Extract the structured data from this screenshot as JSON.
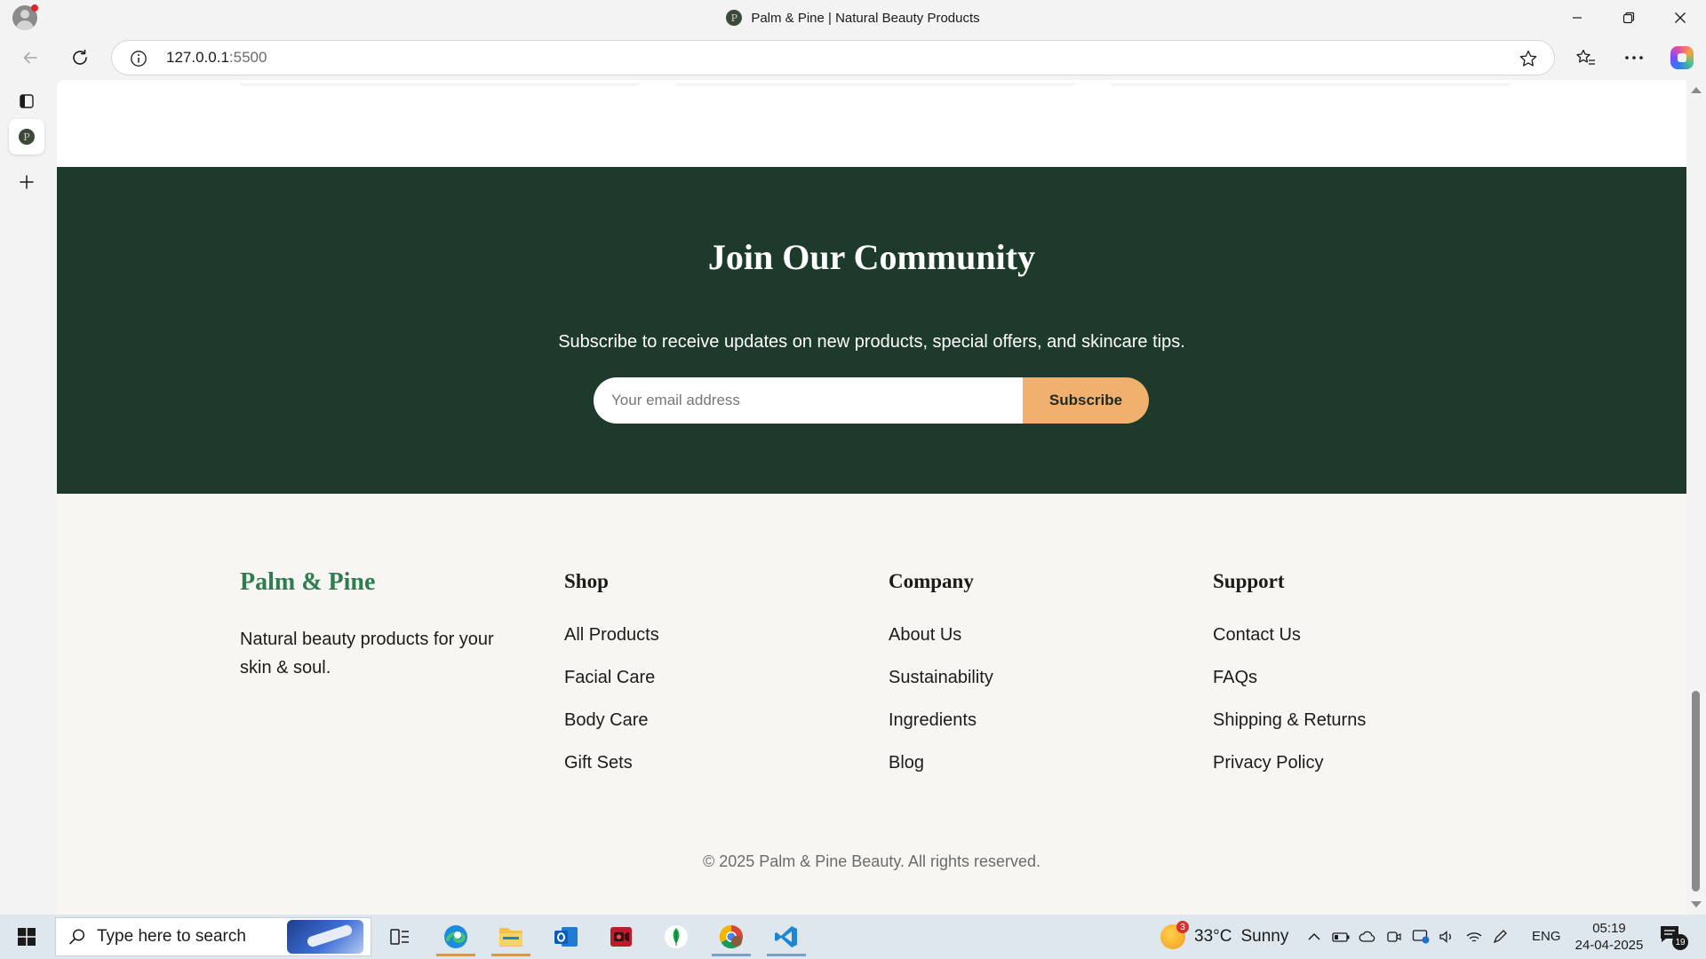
{
  "browser": {
    "window_title": "Palm & Pine | Natural Beauty Products",
    "tab_favicon_letter": "P",
    "url_host": "127.0.0.1",
    "url_port": ":5500"
  },
  "community": {
    "heading": "Join Our Community",
    "text": "Subscribe to receive updates on new products, special offers, and skincare tips.",
    "email_placeholder": "Your email address",
    "email_value": "",
    "subscribe_label": "Subscribe"
  },
  "footer": {
    "brand": "Palm & Pine",
    "tagline": "Natural beauty products for your skin & soul.",
    "columns": [
      {
        "title": "Shop",
        "links": [
          "All Products",
          "Facial Care",
          "Body Care",
          "Gift Sets"
        ]
      },
      {
        "title": "Company",
        "links": [
          "About Us",
          "Sustainability",
          "Ingredients",
          "Blog"
        ]
      },
      {
        "title": "Support",
        "links": [
          "Contact Us",
          "FAQs",
          "Shipping & Returns",
          "Privacy Policy"
        ]
      }
    ],
    "copyright": "© 2025 Palm & Pine Beauty. All rights reserved."
  },
  "taskbar": {
    "search_placeholder": "Type here to search",
    "weather_temp": "33°C",
    "weather_condition": "Sunny",
    "weather_badge": "3",
    "language": "ENG",
    "time": "05:19",
    "date": "24-04-2025",
    "notifications_count": "19"
  },
  "colors": {
    "community_bg": "#1d3a2b",
    "subscribe_button": "#f0b16e",
    "brand_green": "#2e7d50",
    "footer_bg": "#f8f6f2"
  }
}
